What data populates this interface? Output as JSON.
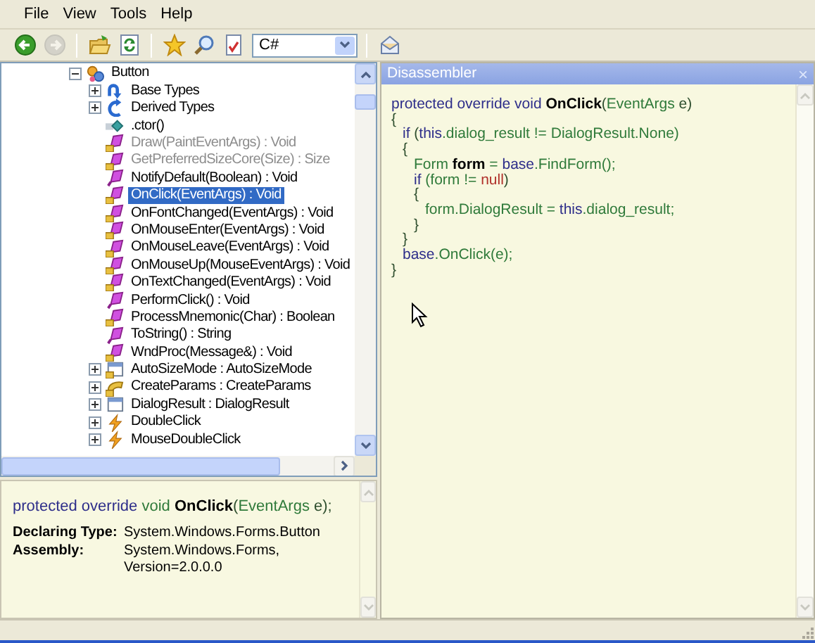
{
  "menu": [
    {
      "label": "File"
    },
    {
      "label": "View"
    },
    {
      "label": "Tools"
    },
    {
      "label": "Help"
    }
  ],
  "toolbar": [
    {
      "kind": "back",
      "disabled": false
    },
    {
      "kind": "forward",
      "disabled": true
    },
    {
      "kind": "separator"
    },
    {
      "kind": "open",
      "disabled": false
    },
    {
      "kind": "refresh",
      "disabled": false
    },
    {
      "kind": "separator"
    },
    {
      "kind": "favorites",
      "disabled": false
    },
    {
      "kind": "search",
      "disabled": false
    },
    {
      "kind": "document",
      "disabled": false
    },
    {
      "kind": "language",
      "value": "C#",
      "disabled": false
    },
    {
      "kind": "separator"
    },
    {
      "kind": "mail",
      "disabled": false
    }
  ],
  "tree": {
    "items": [
      {
        "label": "Button",
        "kind": "class",
        "expanded": true,
        "protected": false,
        "disabled": false,
        "selected": false,
        "children": [
          {
            "label": "Base Types",
            "kind": "base-types",
            "expanded": false,
            "protected": false,
            "disabled": false,
            "selected": false
          },
          {
            "label": "Derived Types",
            "kind": "derived-types",
            "expanded": false,
            "protected": false,
            "disabled": false,
            "selected": false
          },
          {
            "label": ".ctor()",
            "kind": "constructor",
            "protected": false,
            "disabled": false,
            "selected": false
          },
          {
            "label": "Draw(PaintEventArgs) : Void",
            "kind": "method",
            "protected": true,
            "disabled": true,
            "selected": false
          },
          {
            "label": "GetPreferredSizeCore(Size) : Size",
            "kind": "method",
            "protected": true,
            "disabled": true,
            "selected": false
          },
          {
            "label": "NotifyDefault(Boolean) : Void",
            "kind": "method",
            "protected": false,
            "disabled": false,
            "selected": false
          },
          {
            "label": "OnClick(EventArgs) : Void",
            "kind": "method",
            "protected": true,
            "disabled": false,
            "selected": true
          },
          {
            "label": "OnFontChanged(EventArgs) : Void",
            "kind": "method",
            "protected": true,
            "disabled": false,
            "selected": false
          },
          {
            "label": "OnMouseEnter(EventArgs) : Void",
            "kind": "method",
            "protected": true,
            "disabled": false,
            "selected": false
          },
          {
            "label": "OnMouseLeave(EventArgs) : Void",
            "kind": "method",
            "protected": true,
            "disabled": false,
            "selected": false
          },
          {
            "label": "OnMouseUp(MouseEventArgs) : Void",
            "kind": "method",
            "protected": true,
            "disabled": false,
            "selected": false
          },
          {
            "label": "OnTextChanged(EventArgs) : Void",
            "kind": "method",
            "protected": true,
            "disabled": false,
            "selected": false
          },
          {
            "label": "PerformClick() : Void",
            "kind": "method",
            "protected": false,
            "disabled": false,
            "selected": false
          },
          {
            "label": "ProcessMnemonic(Char) : Boolean",
            "kind": "method",
            "protected": true,
            "disabled": false,
            "selected": false
          },
          {
            "label": "ToString() : String",
            "kind": "method",
            "protected": false,
            "disabled": false,
            "selected": false
          },
          {
            "label": "WndProc(Message&) : Void",
            "kind": "method",
            "protected": true,
            "disabled": false,
            "selected": false
          },
          {
            "label": "AutoSizeMode : AutoSizeMode",
            "kind": "property",
            "expanded": false,
            "protected": true,
            "disabled": false,
            "selected": false
          },
          {
            "label": "CreateParams : CreateParams",
            "kind": "property-get",
            "expanded": false,
            "protected": true,
            "disabled": false,
            "selected": false
          },
          {
            "label": "DialogResult : DialogResult",
            "kind": "property",
            "expanded": false,
            "protected": false,
            "disabled": false,
            "selected": false
          },
          {
            "label": "DoubleClick",
            "kind": "event",
            "expanded": false,
            "protected": false,
            "disabled": false,
            "selected": false
          },
          {
            "label": "MouseDoubleClick",
            "kind": "event",
            "expanded": false,
            "protected": false,
            "disabled": false,
            "selected": false
          }
        ]
      }
    ]
  },
  "info": {
    "signature": [
      {
        "text": "protected override ",
        "kind": "kw"
      },
      {
        "text": "void ",
        "kind": "type"
      },
      {
        "text": "OnClick",
        "kind": "name"
      },
      {
        "text": "(",
        "kind": "plain"
      },
      {
        "text": "EventArgs",
        "kind": "type"
      },
      {
        "text": " e);",
        "kind": "plain"
      }
    ],
    "fields": [
      {
        "label": "Declaring Type:",
        "lines": [
          "System.Windows.Forms.Button"
        ]
      },
      {
        "label": "Assembly:",
        "lines": [
          "System.Windows.Forms,",
          "Version=2.0.0.0"
        ]
      }
    ]
  },
  "disassembler": {
    "title": "Disassembler",
    "close": "×",
    "code": [
      {
        "tokens": [
          {
            "text": "protected override void ",
            "kind": "kw"
          },
          {
            "text": "OnClick",
            "kind": "name"
          },
          {
            "text": "(",
            "kind": "plain"
          },
          {
            "text": "EventArgs",
            "kind": "type"
          },
          {
            "text": " e)",
            "kind": "plain"
          }
        ]
      },
      {
        "tokens": [
          {
            "text": "{",
            "kind": "plain"
          }
        ],
        "children": [
          {
            "tokens": [
              {
                "text": "if",
                "kind": "kw"
              },
              {
                "text": " (",
                "kind": "plain"
              },
              {
                "text": "this",
                "kind": "kw"
              },
              {
                "text": ".dialog_result != DialogResult.None)",
                "kind": "ident"
              }
            ]
          },
          {
            "tokens": [
              {
                "text": "{",
                "kind": "plain"
              }
            ],
            "children": [
              {
                "tokens": [
                  {
                    "text": "Form ",
                    "kind": "ident"
                  },
                  {
                    "text": "form",
                    "kind": "name"
                  },
                  {
                    "text": " = ",
                    "kind": "ident"
                  },
                  {
                    "text": "base",
                    "kind": "kw"
                  },
                  {
                    "text": ".FindForm();",
                    "kind": "ident"
                  }
                ]
              },
              {
                "tokens": [
                  {
                    "text": "if",
                    "kind": "kw"
                  },
                  {
                    "text": " (form != ",
                    "kind": "ident"
                  },
                  {
                    "text": "null",
                    "kind": "lit"
                  },
                  {
                    "text": ")",
                    "kind": "plain"
                  }
                ]
              },
              {
                "tokens": [
                  {
                    "text": "{",
                    "kind": "plain"
                  }
                ],
                "children": [
                  {
                    "tokens": [
                      {
                        "text": "form.DialogResult = ",
                        "kind": "ident"
                      },
                      {
                        "text": "this",
                        "kind": "kw"
                      },
                      {
                        "text": ".dialog_result;",
                        "kind": "ident"
                      }
                    ]
                  }
                ]
              },
              {
                "tokens": [
                  {
                    "text": "}",
                    "kind": "plain"
                  }
                ]
              }
            ]
          },
          {
            "tokens": [
              {
                "text": "}",
                "kind": "plain"
              }
            ]
          },
          {
            "tokens": [
              {
                "text": "base",
                "kind": "kw"
              },
              {
                "text": ".OnClick(e);",
                "kind": "ident"
              }
            ]
          }
        ]
      },
      {
        "tokens": [
          {
            "text": "}",
            "kind": "plain"
          }
        ]
      }
    ]
  }
}
